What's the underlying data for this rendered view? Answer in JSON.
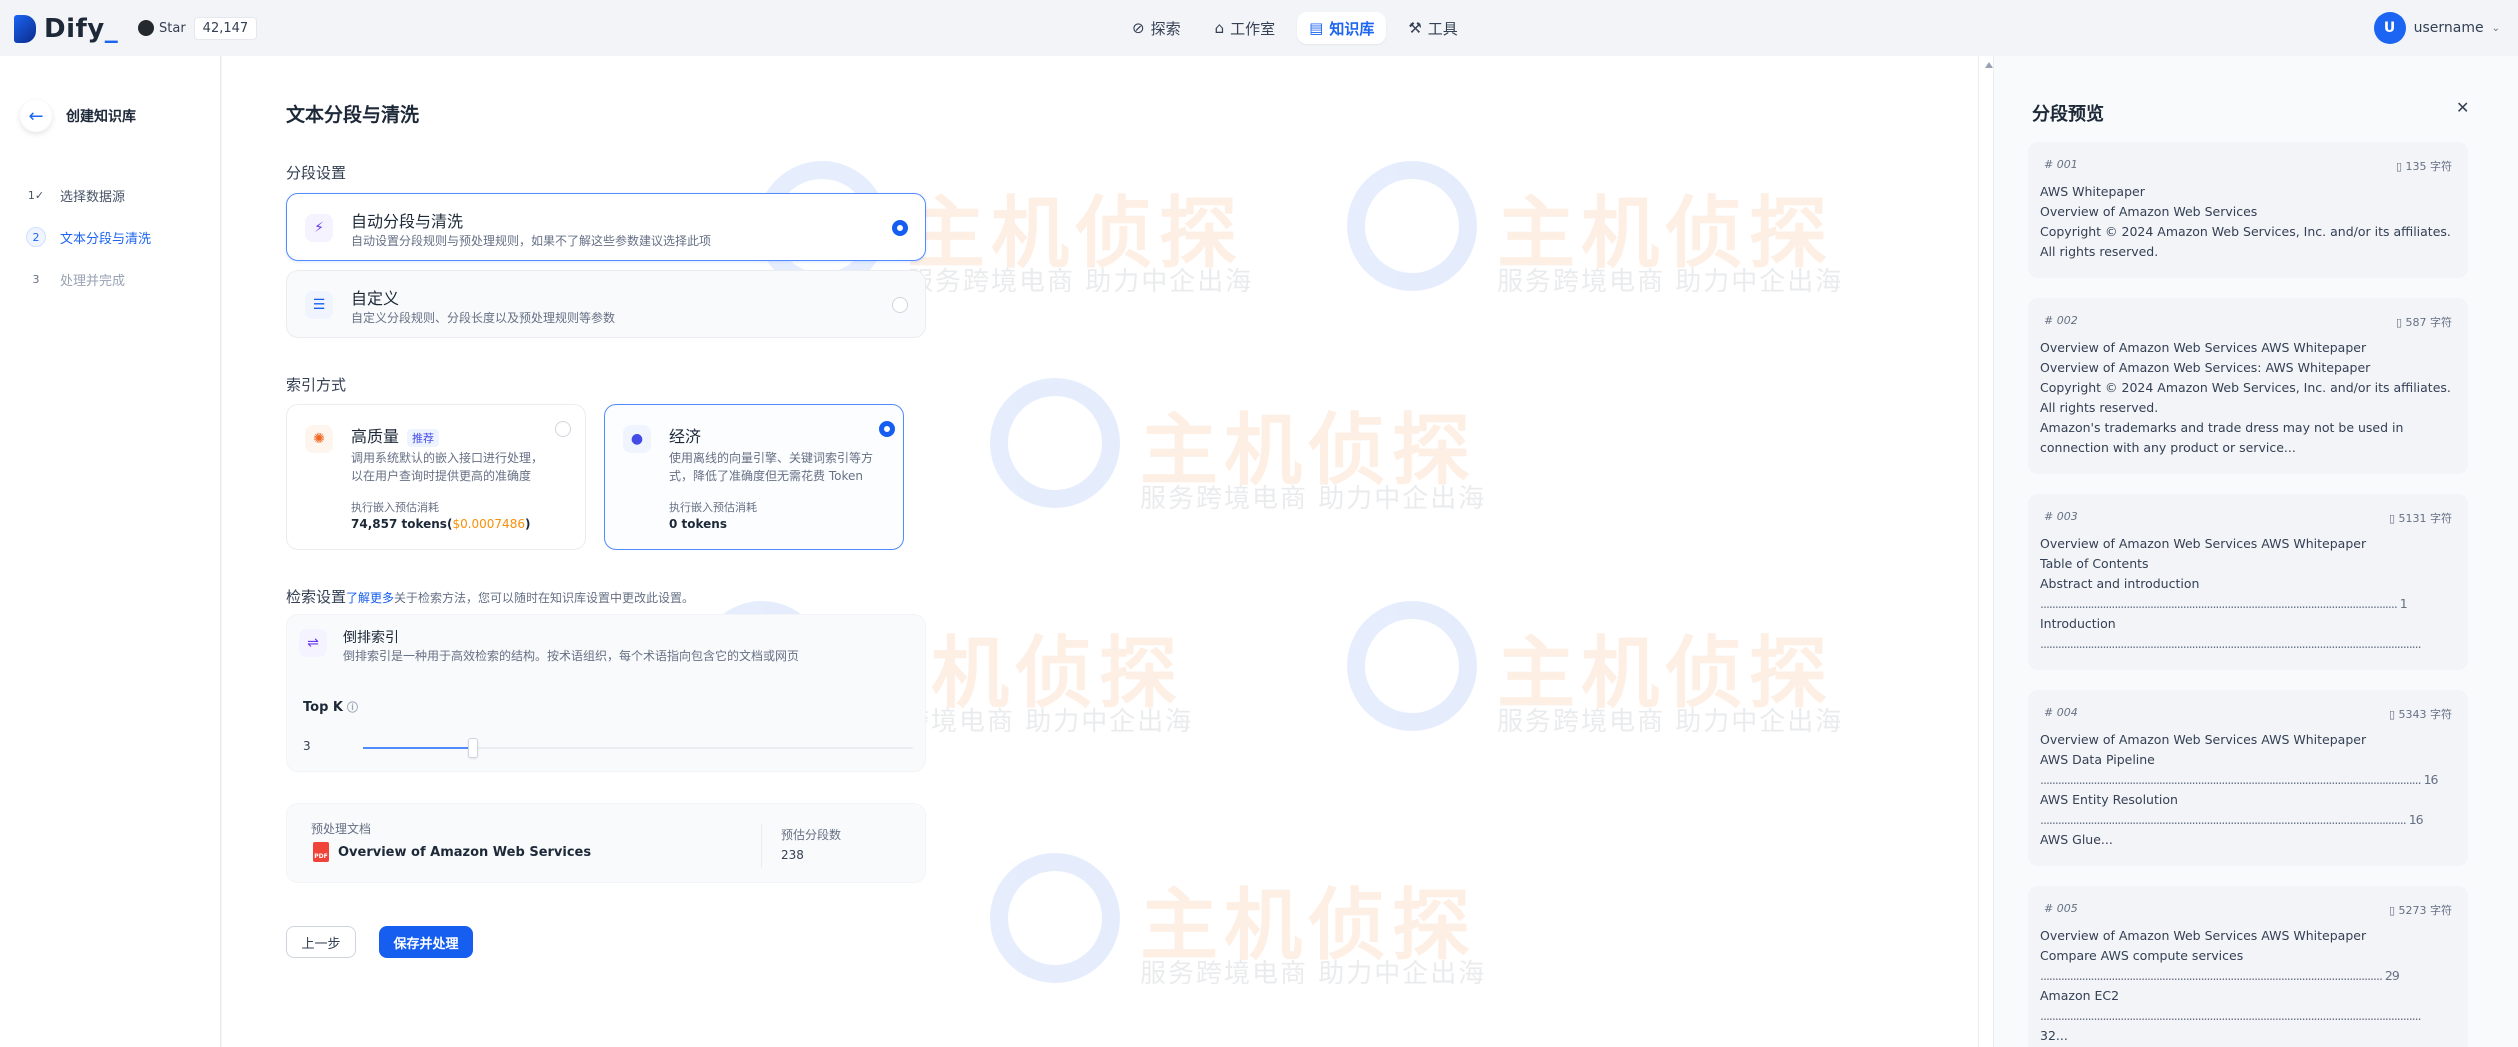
{
  "header": {
    "logo_text": "Dify",
    "github_label": "Star",
    "github_count": "42,147",
    "nav": [
      {
        "label": "探索",
        "icon": "compass-icon"
      },
      {
        "label": "工作室",
        "icon": "studio-icon"
      },
      {
        "label": "知识库",
        "icon": "book-icon",
        "active": true
      },
      {
        "label": "工具",
        "icon": "tool-icon"
      }
    ],
    "user_initial": "U",
    "username": "username"
  },
  "sidebar": {
    "back_label": "创建知识库",
    "steps": [
      {
        "num": "1",
        "label": "选择数据源",
        "state": "done"
      },
      {
        "num": "2",
        "label": "文本分段与清洗",
        "state": "active"
      },
      {
        "num": "3",
        "label": "处理并完成",
        "state": "todo"
      }
    ]
  },
  "main": {
    "title": "文本分段与清洗",
    "segment_label": "分段设置",
    "segment_options": [
      {
        "title": "自动分段与清洗",
        "desc": "自动设置分段规则与预处理规则，如果不了解这些参数建议选择此项",
        "selected": true
      },
      {
        "title": "自定义",
        "desc": "自定义分段规则、分段长度以及预处理规则等参数",
        "selected": false
      }
    ],
    "index_label": "索引方式",
    "index_options": [
      {
        "title": "高质量",
        "badge": "推荐",
        "desc1": "调用系统默认的嵌入接口进行处理，",
        "desc2": "以在用户查询时提供更高的准确度",
        "cost_label": "执行嵌入预估消耗",
        "cost_tokens": "74,857 tokens(",
        "cost_usd": "$0.0007486",
        "cost_close": ")",
        "selected": false
      },
      {
        "title": "经济",
        "desc1": "使用离线的向量引擎、关键词索引等方",
        "desc2": "式，降低了准确度但无需花费 Token",
        "cost_label": "执行嵌入预估消耗",
        "cost_tokens": "0 tokens",
        "selected": true
      }
    ],
    "retrieval": {
      "label": "检索设置",
      "link": "了解更多",
      "hint": "关于检索方法，您可以随时在知识库设置中更改此设置。",
      "method_title": "倒排索引",
      "method_desc": "倒排索引是一种用于高效检索的结构。按术语组织，每个术语指向包含它的文档或网页",
      "topk_label": "Top K",
      "topk_value": "3",
      "topk_fraction": 0.2
    },
    "doc": {
      "label": "预处理文档",
      "name": "Overview of Amazon Web Services",
      "seg_label": "预估分段数",
      "seg_value": "238"
    },
    "buttons": {
      "prev": "上一步",
      "save": "保存并处理"
    }
  },
  "watermark": {
    "title": "主机侦探",
    "subtitle": "服务跨境电商 助力中企出海"
  },
  "preview": {
    "title": "分段预览",
    "chunks": [
      {
        "id": "# 001",
        "count": "135 字符",
        "lines": [
          "AWS Whitepaper",
          "Overview of Amazon Web Services",
          "Copyright © 2024 Amazon Web Services, Inc. and/or its affiliates.",
          "All rights reserved."
        ]
      },
      {
        "id": "# 002",
        "count": "587 字符",
        "lines": [
          "Overview of Amazon Web Services AWS Whitepaper",
          "Overview of Amazon Web Services: AWS Whitepaper",
          "Copyright © 2024 Amazon Web Services, Inc. and/or its affiliates.",
          "All rights reserved.",
          "Amazon's trademarks and trade dress may not be used in",
          "connection with any product or service..."
        ]
      },
      {
        "id": "# 003",
        "count": "5131 字符",
        "lines": [
          "Overview of Amazon Web Services AWS Whitepaper",
          "Table of Contents",
          "Abstract and introduction",
          "........................................................................................................................ 1",
          "Introduction",
          "................................................................................................................................"
        ]
      },
      {
        "id": "# 004",
        "count": "5343 字符",
        "lines": [
          "Overview of Amazon Web Services AWS Whitepaper",
          "AWS Data Pipeline",
          "................................................................................................................................ 16",
          "AWS Entity Resolution",
          "........................................................................................................................... 16",
          "AWS Glue..."
        ]
      },
      {
        "id": "# 005",
        "count": "5273 字符",
        "lines": [
          "Overview of Amazon Web Services AWS Whitepaper",
          "Compare AWS compute services",
          "................................................................................................................... 29",
          "Amazon EC2",
          "................................................................................................................................",
          "32..."
        ]
      }
    ]
  }
}
